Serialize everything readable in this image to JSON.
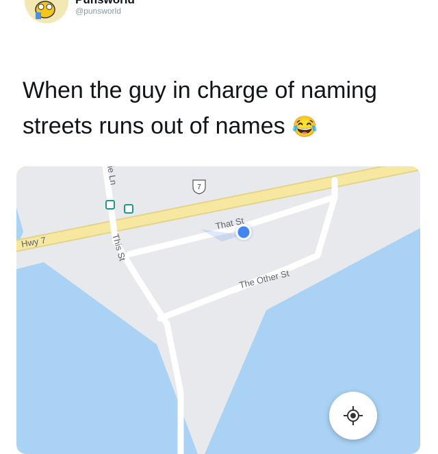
{
  "tweet": {
    "display_name": "Punsworld™",
    "handle": "@punsworld",
    "text": "When the guy in charge of naming streets runs out of names",
    "emoji": "😂"
  },
  "map": {
    "labels": {
      "hwy": "Hwy 7",
      "route_shield": "7",
      "partial_street": "ie Ln",
      "this_st": "This St",
      "that_st": "That St",
      "other_st": "The Other St"
    },
    "colors": {
      "land": "#e8e9ec",
      "water": "#a9d2f5",
      "highway": "#f6e7a1",
      "location_dot": "#4285f4",
      "transit": "#1a9a8a"
    },
    "icons": [
      "route-shield-icon",
      "transit-stop-icon",
      "location-dot-icon",
      "recenter-icon"
    ]
  }
}
